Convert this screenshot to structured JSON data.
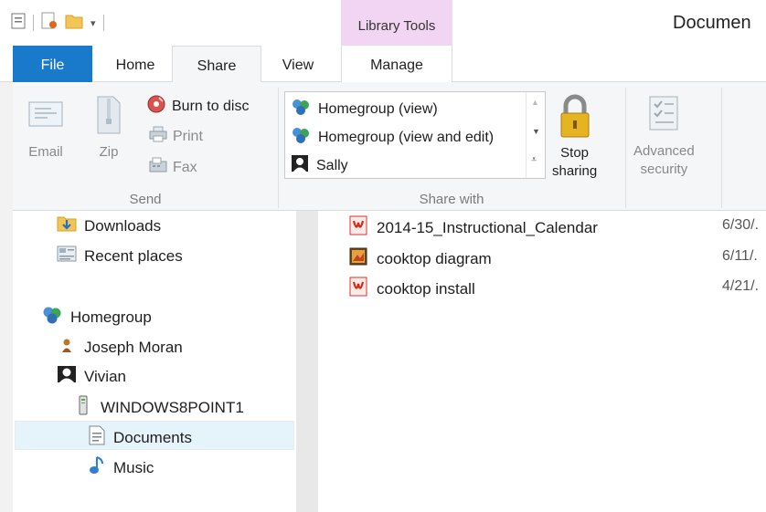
{
  "window": {
    "title": "Documen",
    "context_group": "Library Tools"
  },
  "tabs": {
    "file": "File",
    "home": "Home",
    "share": "Share",
    "view": "View",
    "manage": "Manage"
  },
  "ribbon": {
    "send": {
      "group_label": "Send",
      "email": "Email",
      "zip": "Zip",
      "burn": "Burn to disc",
      "print": "Print",
      "fax": "Fax"
    },
    "share_with": {
      "group_label": "Share with",
      "items": [
        {
          "label": "Homegroup (view)",
          "icon": "homegroup-icon"
        },
        {
          "label": "Homegroup (view and edit)",
          "icon": "homegroup-icon"
        },
        {
          "label": "Sally",
          "icon": "user-icon"
        }
      ],
      "stop_sharing_line1": "Stop",
      "stop_sharing_line2": "sharing",
      "advanced_line1": "Advanced",
      "advanced_line2": "security"
    }
  },
  "nav": {
    "items": [
      {
        "label": "Downloads",
        "icon": "downloads-folder-icon"
      },
      {
        "label": "Recent places",
        "icon": "recent-places-icon"
      },
      {
        "label": "Homegroup",
        "icon": "homegroup-icon"
      },
      {
        "label": "Joseph Moran",
        "icon": "user-icon"
      },
      {
        "label": "Vivian",
        "icon": "user-icon"
      },
      {
        "label": "WINDOWS8POINT1",
        "icon": "computer-icon"
      },
      {
        "label": "Documents",
        "icon": "documents-icon"
      },
      {
        "label": "Music",
        "icon": "music-icon"
      }
    ]
  },
  "files": [
    {
      "name": "2014-15_Instructional_Calendar",
      "date": "6/30/.",
      "icon": "pdf-icon"
    },
    {
      "name": "cooktop diagram",
      "date": "6/11/.",
      "icon": "image-file-icon"
    },
    {
      "name": "cooktop install",
      "date": "4/21/.",
      "icon": "pdf-icon"
    }
  ],
  "colors": {
    "file_tab": "#1979ca",
    "context_group": "#f2d5f2",
    "ribbon_bg": "#f5f6f7",
    "selected_nav": "#e5f3fb"
  }
}
